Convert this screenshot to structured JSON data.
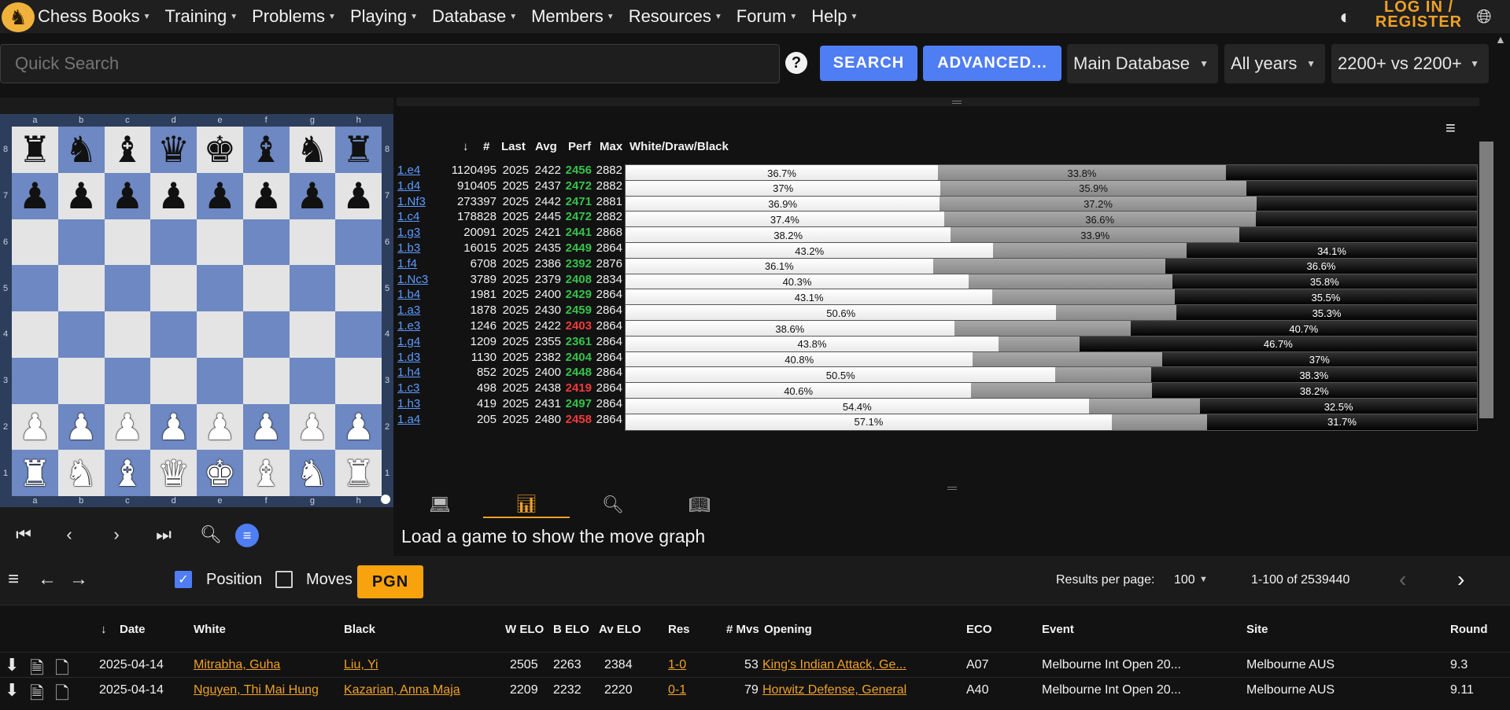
{
  "nav": {
    "logo": "♞",
    "items": [
      "Chess Books",
      "Training",
      "Problems",
      "Playing",
      "Database",
      "Members",
      "Resources",
      "Forum",
      "Help"
    ],
    "login": "LOG IN / REGISTER",
    "theme_icon": "contrast-icon",
    "globe_icon": "globe-icon"
  },
  "search": {
    "placeholder": "Quick Search",
    "help": "?",
    "search_label": "SEARCH",
    "advanced_label": "ADVANCED...",
    "database": "Main Database",
    "years": "All years",
    "elo": "2200+ vs 2200+"
  },
  "board": {
    "files": [
      "a",
      "b",
      "c",
      "d",
      "e",
      "f",
      "g",
      "h"
    ],
    "ranks": [
      "8",
      "7",
      "6",
      "5",
      "4",
      "3",
      "2",
      "1"
    ],
    "position": [
      [
        "r",
        "n",
        "b",
        "q",
        "k",
        "b",
        "n",
        "r"
      ],
      [
        "p",
        "p",
        "p",
        "p",
        "p",
        "p",
        "p",
        "p"
      ],
      [
        "",
        "",
        "",
        "",
        "",
        "",
        "",
        ""
      ],
      [
        "",
        "",
        "",
        "",
        "",
        "",
        "",
        ""
      ],
      [
        "",
        "",
        "",
        "",
        "",
        "",
        "",
        ""
      ],
      [
        "",
        "",
        "",
        "",
        "",
        "",
        "",
        ""
      ],
      [
        "P",
        "P",
        "P",
        "P",
        "P",
        "P",
        "P",
        "P"
      ],
      [
        "R",
        "N",
        "B",
        "Q",
        "K",
        "B",
        "N",
        "R"
      ]
    ]
  },
  "explorer": {
    "headers": {
      "sort": "↓",
      "count": "#",
      "last": "Last",
      "avg": "Avg",
      "perf": "Perf",
      "max": "Max",
      "wdb": "White/Draw/Black"
    },
    "rows": [
      {
        "move": "1.e4",
        "count": "1120495",
        "last": "2025",
        "avg": "2422",
        "perf": "2456",
        "perf_color": "green",
        "max": "2882",
        "w": 36.7,
        "d": 33.8,
        "w_label": "36.7%",
        "d_label": "33.8%",
        "b_label": ""
      },
      {
        "move": "1.d4",
        "count": "910405",
        "last": "2025",
        "avg": "2437",
        "perf": "2472",
        "perf_color": "green",
        "max": "2882",
        "w": 37.0,
        "d": 35.9,
        "w_label": "37%",
        "d_label": "35.9%",
        "b_label": ""
      },
      {
        "move": "1.Nf3",
        "count": "273397",
        "last": "2025",
        "avg": "2442",
        "perf": "2471",
        "perf_color": "green",
        "max": "2881",
        "w": 36.9,
        "d": 37.2,
        "w_label": "36.9%",
        "d_label": "37.2%",
        "b_label": ""
      },
      {
        "move": "1.c4",
        "count": "178828",
        "last": "2025",
        "avg": "2445",
        "perf": "2472",
        "perf_color": "green",
        "max": "2882",
        "w": 37.4,
        "d": 36.6,
        "w_label": "37.4%",
        "d_label": "36.6%",
        "b_label": ""
      },
      {
        "move": "1.g3",
        "count": "20091",
        "last": "2025",
        "avg": "2421",
        "perf": "2441",
        "perf_color": "green",
        "max": "2868",
        "w": 38.2,
        "d": 33.9,
        "w_label": "38.2%",
        "d_label": "33.9%",
        "b_label": ""
      },
      {
        "move": "1.b3",
        "count": "16015",
        "last": "2025",
        "avg": "2435",
        "perf": "2449",
        "perf_color": "green",
        "max": "2864",
        "w": 43.2,
        "d": 22.7,
        "w_label": "43.2%",
        "d_label": "",
        "b_label": "34.1%"
      },
      {
        "move": "1.f4",
        "count": "6708",
        "last": "2025",
        "avg": "2386",
        "perf": "2392",
        "perf_color": "green",
        "max": "2876",
        "w": 36.1,
        "d": 27.3,
        "w_label": "36.1%",
        "d_label": "",
        "b_label": "36.6%"
      },
      {
        "move": "1.Nc3",
        "count": "3789",
        "last": "2025",
        "avg": "2379",
        "perf": "2408",
        "perf_color": "green",
        "max": "2834",
        "w": 40.3,
        "d": 23.9,
        "w_label": "40.3%",
        "d_label": "",
        "b_label": "35.8%"
      },
      {
        "move": "1.b4",
        "count": "1981",
        "last": "2025",
        "avg": "2400",
        "perf": "2429",
        "perf_color": "green",
        "max": "2864",
        "w": 43.1,
        "d": 21.4,
        "w_label": "43.1%",
        "d_label": "",
        "b_label": "35.5%"
      },
      {
        "move": "1.a3",
        "count": "1878",
        "last": "2025",
        "avg": "2430",
        "perf": "2459",
        "perf_color": "green",
        "max": "2864",
        "w": 50.6,
        "d": 14.1,
        "w_label": "50.6%",
        "d_label": "",
        "b_label": "35.3%"
      },
      {
        "move": "1.e3",
        "count": "1246",
        "last": "2025",
        "avg": "2422",
        "perf": "2403",
        "perf_color": "red",
        "max": "2864",
        "w": 38.6,
        "d": 20.7,
        "w_label": "38.6%",
        "d_label": "",
        "b_label": "40.7%"
      },
      {
        "move": "1.g4",
        "count": "1209",
        "last": "2025",
        "avg": "2355",
        "perf": "2361",
        "perf_color": "green",
        "max": "2864",
        "w": 43.8,
        "d": 9.5,
        "w_label": "43.8%",
        "d_label": "",
        "b_label": "46.7%"
      },
      {
        "move": "1.d3",
        "count": "1130",
        "last": "2025",
        "avg": "2382",
        "perf": "2404",
        "perf_color": "green",
        "max": "2864",
        "w": 40.8,
        "d": 22.2,
        "w_label": "40.8%",
        "d_label": "",
        "b_label": "37%"
      },
      {
        "move": "1.h4",
        "count": "852",
        "last": "2025",
        "avg": "2400",
        "perf": "2448",
        "perf_color": "green",
        "max": "2864",
        "w": 50.5,
        "d": 11.2,
        "w_label": "50.5%",
        "d_label": "",
        "b_label": "38.3%"
      },
      {
        "move": "1.c3",
        "count": "498",
        "last": "2025",
        "avg": "2438",
        "perf": "2419",
        "perf_color": "red",
        "max": "2864",
        "w": 40.6,
        "d": 21.2,
        "w_label": "40.6%",
        "d_label": "",
        "b_label": "38.2%"
      },
      {
        "move": "1.h3",
        "count": "419",
        "last": "2025",
        "avg": "2431",
        "perf": "2497",
        "perf_color": "green",
        "max": "2864",
        "w": 54.4,
        "d": 13.1,
        "w_label": "54.4%",
        "d_label": "",
        "b_label": "32.5%"
      },
      {
        "move": "1.a4",
        "count": "205",
        "last": "2025",
        "avg": "2480",
        "perf": "2458",
        "perf_color": "red",
        "max": "2864",
        "w": 57.1,
        "d": 11.2,
        "w_label": "57.1%",
        "d_label": "",
        "b_label": "31.7%"
      }
    ]
  },
  "tabs": {
    "items": [
      "laptop-icon",
      "bar-chart-icon",
      "search-doc-icon",
      "book-icon"
    ],
    "active": 1,
    "message": "Load a game to show the move graph"
  },
  "games": {
    "position_label": "Position",
    "moves_label": "Moves",
    "pgn_label": "PGN",
    "rpp_label": "Results per page:",
    "rpp_value": "100",
    "range": "1-100 of 2539440",
    "headers": {
      "sort": "↓",
      "date": "Date",
      "white": "White",
      "black": "Black",
      "welo": "W ELO",
      "belo": "B ELO",
      "avelo": "Av ELO",
      "res": "Res",
      "mvs": "# Mvs",
      "opening": "Opening",
      "eco": "ECO",
      "event": "Event",
      "site": "Site",
      "round": "Round"
    },
    "rows": [
      {
        "date": "2025-04-14",
        "white": "Mitrabha, Guha",
        "black": "Liu, Yi",
        "welo": "2505",
        "belo": "2263",
        "avelo": "2384",
        "res": "1-0",
        "mvs": "53",
        "opening": "King's Indian Attack, Ge...",
        "eco": "A07",
        "event": "Melbourne Int Open 20...",
        "site": "Melbourne AUS",
        "round": "9.3"
      },
      {
        "date": "2025-04-14",
        "white": "Nguyen, Thi Mai Hung",
        "black": "Kazarian, Anna Maja",
        "welo": "2209",
        "belo": "2232",
        "avelo": "2220",
        "res": "0-1",
        "mvs": "79",
        "opening": "Horwitz Defense, General",
        "eco": "A40",
        "event": "Melbourne Int Open 20...",
        "site": "Melbourne AUS",
        "round": "9.11"
      }
    ]
  }
}
